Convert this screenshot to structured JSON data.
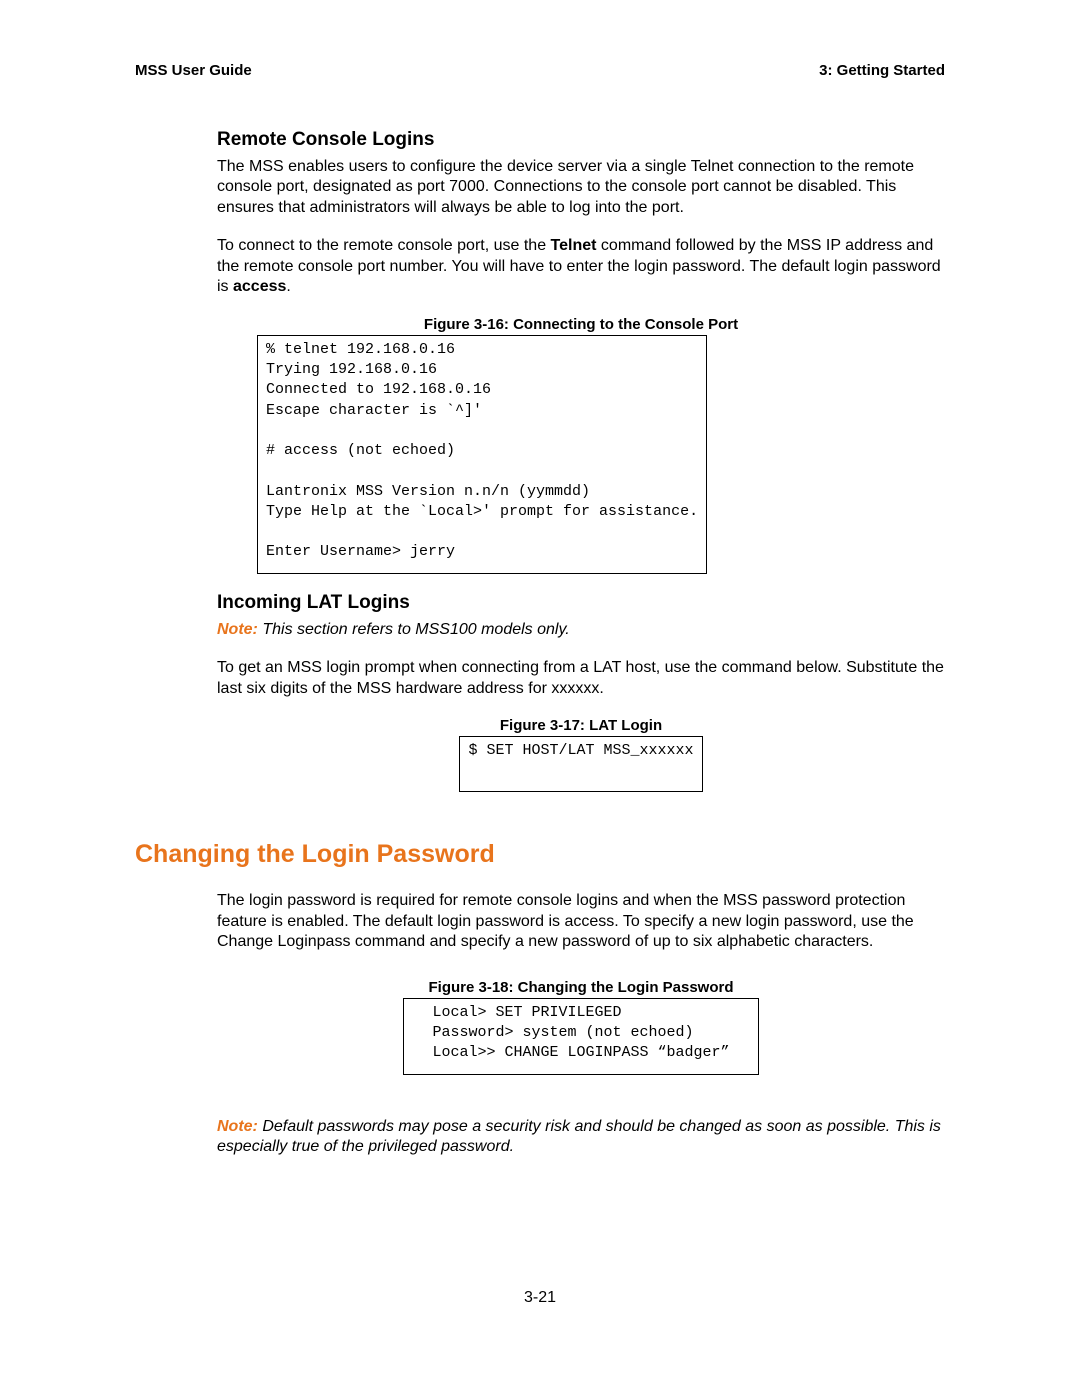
{
  "header": {
    "left": "MSS User Guide",
    "right": "3:  Getting Started"
  },
  "s1": {
    "title": "Remote Console Logins",
    "p1": "The MSS enables users to configure the device server via a single Telnet connection to the remote console port, designated as port 7000. Connections to the console port cannot be disabled. This ensures that administrators will always be able to log into the port.",
    "p2a": "To connect to the remote console port, use the ",
    "p2b": "Telnet",
    "p2c": " command followed by the MSS IP address and the remote console port number. You will have to enter the login password. The default login password is ",
    "p2d": "access",
    "p2e": "."
  },
  "fig16": {
    "caption": "Figure 3-16:  Connecting to the Console Port",
    "code": "% telnet 192.168.0.16\nTrying 192.168.0.16\nConnected to 192.168.0.16\nEscape character is `^]'\n\n# access (not echoed)\n\nLantronix MSS Version n.n/n (yymmdd)\nType Help at the `Local>' prompt for assistance.\n\nEnter Username> jerry"
  },
  "s2": {
    "title": "Incoming LAT Logins",
    "note_label": "Note:",
    "note_body": " This section refers to MSS100 models only.",
    "p1": "To get an MSS login prompt when connecting from a LAT host, use the command below. Substitute the last six digits of the MSS hardware address for xxxxxx."
  },
  "fig17": {
    "caption": "Figure 3-17: LAT Login",
    "code": "$ SET HOST/LAT MSS_xxxxxx\n "
  },
  "s3": {
    "title": "Changing the Login Password",
    "p1": "The login password is required for remote console logins and when the MSS password protection feature is enabled. The default login password is access. To specify a new login password, use the Change Loginpass command and specify a new password of up to six alphabetic characters."
  },
  "fig18": {
    "caption": "Figure 3-18: Changing the Login Password",
    "code": "Local> SET PRIVILEGED\nPassword> system (not echoed)\nLocal>> CHANGE LOGINPASS “badger”"
  },
  "s4": {
    "note_label": "Note:",
    "note_body": " Default passwords may pose a security risk and should be changed as soon as possible. This is especially true of the privileged password."
  },
  "page_number": "3-21"
}
